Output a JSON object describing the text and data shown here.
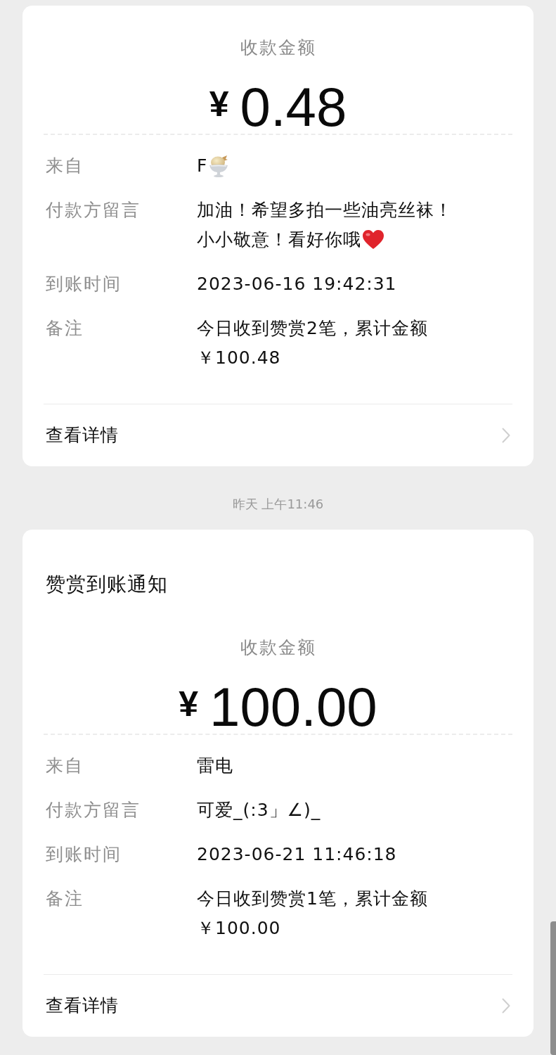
{
  "messages": [
    {
      "kind": "card",
      "amount_label": "收款金额",
      "currency": "¥",
      "amount": "0.48",
      "rows": [
        {
          "label": "来自",
          "kind": "icecream",
          "lines": [
            "F"
          ]
        },
        {
          "label": "付款方留言",
          "kind": "heart",
          "lines": [
            "加油！希望多拍一些油亮丝袜！",
            "小小敬意！看好你哦"
          ]
        },
        {
          "label": "到账时间",
          "kind": "text",
          "lines": [
            "2023-06-16 19:42:31"
          ]
        },
        {
          "label": "备注",
          "kind": "text",
          "lines": [
            "今日收到赞赏2笔，累计金额￥100.48"
          ]
        }
      ],
      "details_link": "查看详情"
    },
    {
      "kind": "timestamp",
      "text": "昨天 上午11:46"
    },
    {
      "kind": "card",
      "title": "赞赏到账通知",
      "amount_label": "收款金额",
      "currency": "¥",
      "amount": "100.00",
      "rows": [
        {
          "label": "来自",
          "kind": "text",
          "lines": [
            "雷电"
          ]
        },
        {
          "label": "付款方留言",
          "kind": "text",
          "lines": [
            "可爱_(:3」∠)_"
          ]
        },
        {
          "label": "到账时间",
          "kind": "text",
          "lines": [
            "2023-06-21 11:46:18"
          ]
        },
        {
          "label": "备注",
          "kind": "text",
          "lines": [
            "今日收到赞赏1笔，累计金额￥100.00"
          ]
        }
      ],
      "details_link": "查看详情"
    }
  ]
}
